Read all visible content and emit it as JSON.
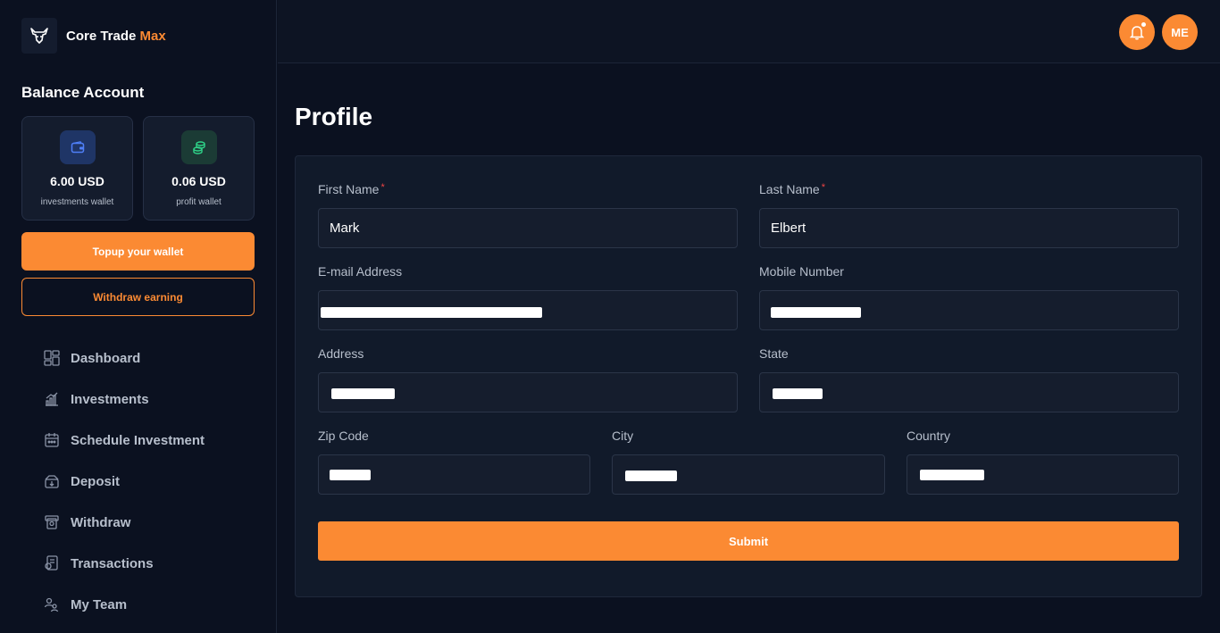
{
  "brand": {
    "name_main": "Core Trade",
    "name_accent": "Max",
    "accent_color": "#fb8a33"
  },
  "sidebar": {
    "balance_title": "Balance Account",
    "wallets": [
      {
        "amount": "6.00 USD",
        "label": "investments wallet",
        "icon": "wallet-icon"
      },
      {
        "amount": "0.06 USD",
        "label": "profit wallet",
        "icon": "coins-icon"
      }
    ],
    "topup_label": "Topup your wallet",
    "withdraw_label": "Withdraw earning",
    "nav": [
      {
        "label": "Dashboard",
        "icon": "dashboard-icon"
      },
      {
        "label": "Investments",
        "icon": "chart-icon"
      },
      {
        "label": "Schedule Investment",
        "icon": "calendar-icon"
      },
      {
        "label": "Deposit",
        "icon": "deposit-icon"
      },
      {
        "label": "Withdraw",
        "icon": "withdraw-icon"
      },
      {
        "label": "Transactions",
        "icon": "transactions-icon"
      },
      {
        "label": "My Team",
        "icon": "team-icon"
      }
    ]
  },
  "topbar": {
    "avatar_initials": "ME",
    "notification_icon": "bell-icon"
  },
  "main": {
    "page_title": "Profile",
    "form": {
      "first_name": {
        "label": "First Name",
        "required": "*",
        "value": "Mark"
      },
      "last_name": {
        "label": "Last Name",
        "required": "*",
        "value": "Elbert"
      },
      "email": {
        "label": "E-mail Address",
        "value": ""
      },
      "mobile": {
        "label": "Mobile Number",
        "value": ""
      },
      "address": {
        "label": "Address",
        "value": ""
      },
      "state": {
        "label": "State",
        "value": ""
      },
      "zip": {
        "label": "Zip Code",
        "value": ""
      },
      "city": {
        "label": "City",
        "value": ""
      },
      "country": {
        "label": "Country",
        "value": ""
      },
      "submit_label": "Submit"
    }
  }
}
